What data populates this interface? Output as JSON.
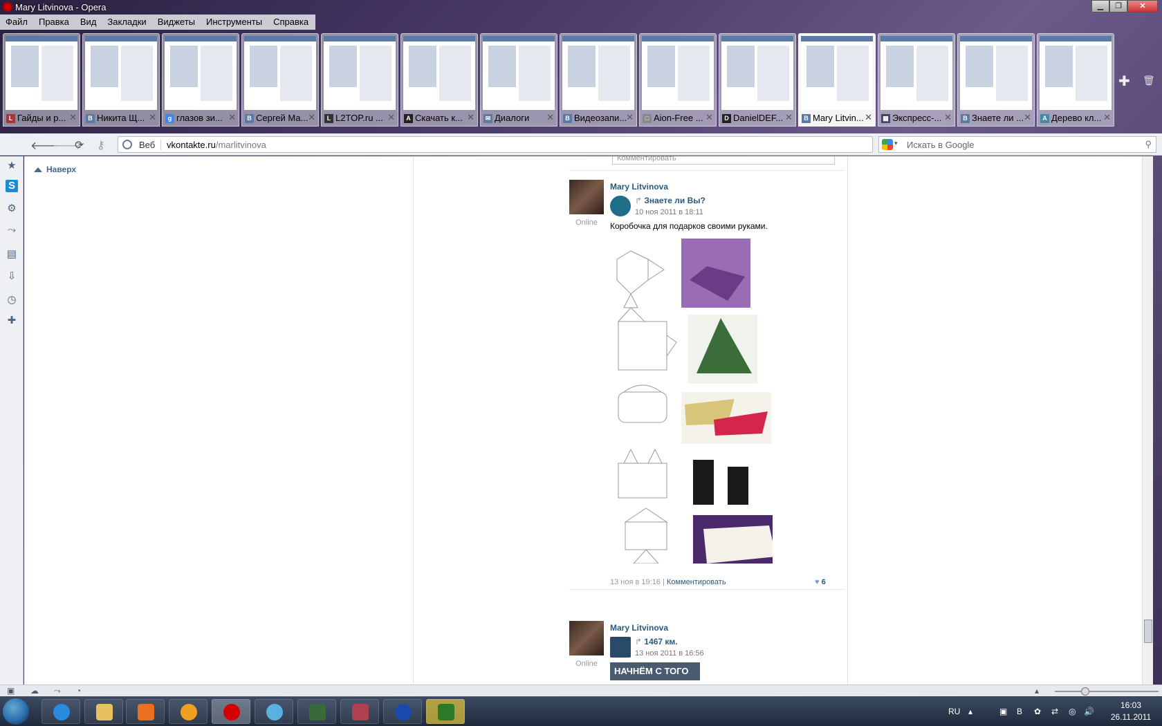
{
  "window": {
    "title": "Mary Litvinova - Opera"
  },
  "menu": [
    "Файл",
    "Правка",
    "Вид",
    "Закладки",
    "Виджеты",
    "Инструменты",
    "Справка"
  ],
  "tabs": [
    {
      "label": "Гайды и р...",
      "icon": "L",
      "color": "#a33"
    },
    {
      "label": "Никита Щ...",
      "icon": "В",
      "color": "#5b7aa5"
    },
    {
      "label": "глазов зи...",
      "icon": "g",
      "color": "#4285f4"
    },
    {
      "label": "Сергей Ма...",
      "icon": "В",
      "color": "#5b7aa5"
    },
    {
      "label": "L2TOP.ru ...",
      "icon": "L",
      "color": "#333"
    },
    {
      "label": "Скачать к...",
      "icon": "A",
      "color": "#222"
    },
    {
      "label": "Диалоги",
      "icon": "✉",
      "color": "#5b7aa5"
    },
    {
      "label": "Видеозапи...",
      "icon": "В",
      "color": "#5b7aa5"
    },
    {
      "label": "Aion-Free ...",
      "icon": "□",
      "color": "#888"
    },
    {
      "label": "DanielDEF...",
      "icon": "D",
      "color": "#222"
    },
    {
      "label": "Mary Litvin...",
      "icon": "В",
      "color": "#5b7aa5",
      "active": true
    },
    {
      "label": "Экспресс-...",
      "icon": "▦",
      "color": "#446"
    },
    {
      "label": "Знаете ли ...",
      "icon": "В",
      "color": "#5b7aa5"
    },
    {
      "label": "Дерево кл...",
      "icon": "A",
      "color": "#48a"
    }
  ],
  "address": {
    "mode": "Веб",
    "host": "vkontakte.ru",
    "path": "/marlitvinova"
  },
  "search": {
    "placeholder": "Искать в Google"
  },
  "page": {
    "back_to_top": "Наверх",
    "comment_placeholder": "Комментировать",
    "posts": [
      {
        "author": "Mary Litvinova",
        "status": "Online",
        "source": "Знаете ли Вы?",
        "date": "10 ноя 2011 в 18:11",
        "text": "Коробочка для подарков своими руками.",
        "footer_date": "13 ноя в 19:16",
        "footer_sep": "|",
        "footer_action": "Комментировать",
        "likes": "6"
      },
      {
        "author": "Mary Litvinova",
        "status": "Online",
        "source": "1467 км.",
        "date": "13 ноя 2011 в 16:56",
        "banner": "НАЧНЁМ С ТОГО"
      }
    ]
  },
  "tray": {
    "lang": "RU",
    "time": "16:03",
    "date": "26.11.2011"
  },
  "colors": {
    "vk_link": "#2b587a",
    "accent": "#45688e"
  }
}
